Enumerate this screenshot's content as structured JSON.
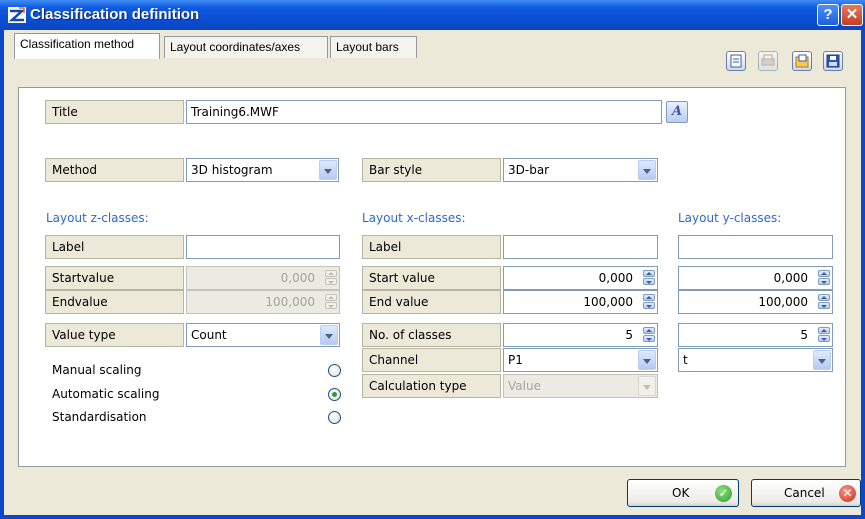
{
  "window": {
    "title": "Classification definition",
    "help_glyph": "?",
    "close_glyph": "✕"
  },
  "tabs": [
    {
      "label": "Classification method",
      "active": true
    },
    {
      "label": "Layout coordinates/axes",
      "active": false
    },
    {
      "label": "Layout bars",
      "active": false
    }
  ],
  "toolbar_icons": [
    "new-document-icon",
    "print-icon",
    "open-icon",
    "save-icon"
  ],
  "title_row": {
    "label": "Title",
    "value": "Training6.MWF",
    "style_button_glyph": "A"
  },
  "method": {
    "label": "Method",
    "value": "3D histogram"
  },
  "bar_style": {
    "label": "Bar style",
    "value": "3D-bar"
  },
  "z_classes": {
    "heading": "Layout z-classes:",
    "label_label": "Label",
    "label_value": "",
    "startvalue_label": "Startvalue",
    "startvalue": "0,000",
    "endvalue_label": "Endvalue",
    "endvalue": "100,000",
    "value_type_label": "Value type",
    "value_type": "Count",
    "scaling": [
      {
        "label": "Manual scaling",
        "selected": false
      },
      {
        "label": "Automatic scaling",
        "selected": true
      },
      {
        "label": "Standardisation",
        "selected": false
      }
    ]
  },
  "x_classes": {
    "heading": "Layout x-classes:",
    "label_label": "Label",
    "label_value": "",
    "start_label": "Start value",
    "start": "0,000",
    "end_label": "End value",
    "end": "100,000",
    "classes_label": "No. of classes",
    "classes": "5",
    "channel_label": "Channel",
    "channel": "P1",
    "calc_label": "Calculation type",
    "calc": "Value"
  },
  "y_classes": {
    "heading": "Layout y-classes:",
    "label_value": "",
    "start": "0,000",
    "end": "100,000",
    "classes": "5",
    "channel": "t"
  },
  "buttons": {
    "ok": "OK",
    "cancel": "Cancel"
  },
  "colors": {
    "titlebar": "#0a4fd6",
    "dialog_bg": "#ece9d8",
    "section_heading": "#3266cc",
    "ok_icon": "#2f9a2d",
    "cancel_icon": "#cc2a14"
  }
}
